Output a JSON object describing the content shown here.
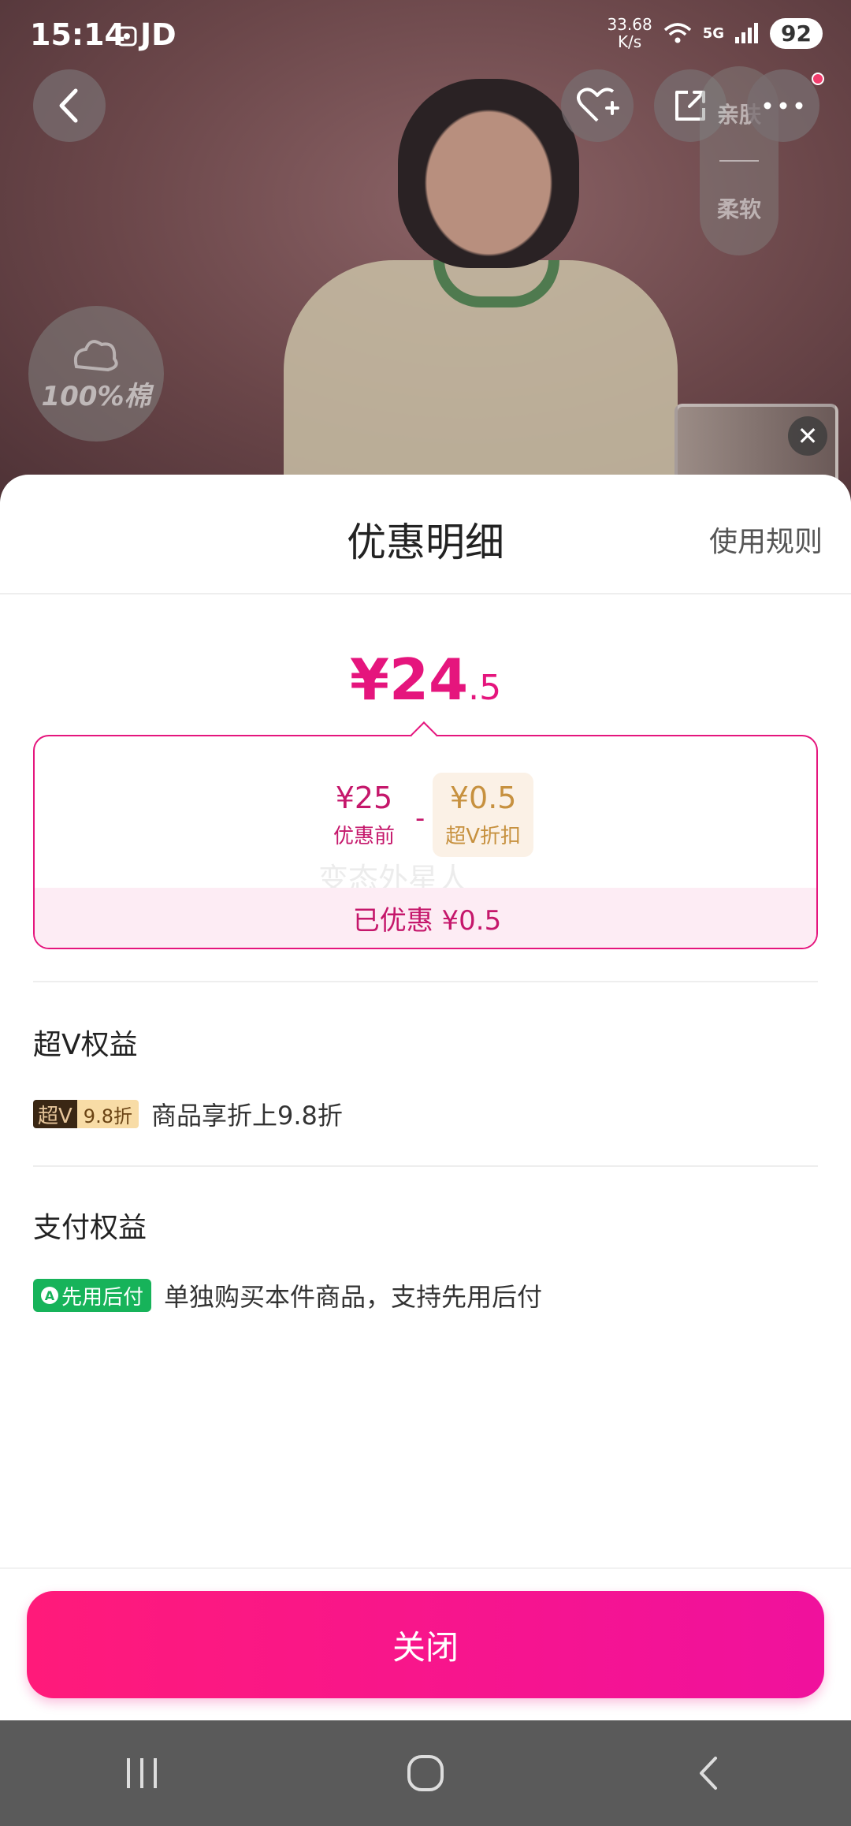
{
  "status_bar": {
    "time": "15:14",
    "carrier_label": "JD",
    "net_speed_value": "33.68",
    "net_speed_unit": "K/s",
    "network_type": "5G",
    "battery": "92"
  },
  "product_overlay": {
    "badge_cotton": "100%棉",
    "badge_skin": "亲肤",
    "badge_soft": "柔软"
  },
  "sheet": {
    "title": "优惠明细",
    "rules_link": "使用规则",
    "final_price_int": "¥24",
    "final_price_dec": ".5",
    "original_amount": "¥25",
    "original_label": "优惠前",
    "minus": "-",
    "discount_amount": "¥0.5",
    "discount_label": "超V折扣",
    "watermark": "变态外星人",
    "saved_text": "已优惠 ¥0.5",
    "vip_section_title": "超V权益",
    "vip_tag_left": "超V",
    "vip_tag_right": "9.8折",
    "vip_benefit_text": "商品享折上9.8折",
    "pay_section_title": "支付权益",
    "pay_tag": "先用后付",
    "pay_benefit_text": "单独购买本件商品，支持先用后付",
    "close_button": "关闭"
  },
  "colors": {
    "accent": "#e5157d",
    "discount_gold": "#c7913f",
    "pay_green": "#17b35a"
  },
  "icons": [
    "back-icon",
    "favorite-add-icon",
    "share-icon",
    "more-icon",
    "close-icon",
    "nav-recents-icon",
    "nav-home-icon",
    "nav-back-icon"
  ]
}
